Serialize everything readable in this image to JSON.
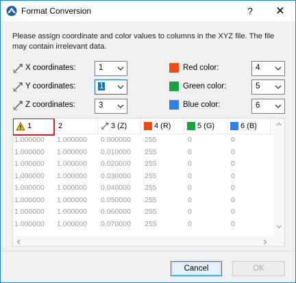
{
  "window": {
    "title": "Format Conversion",
    "help_glyph": "?",
    "close_glyph": "✕"
  },
  "instructions": "Please assign coordinate and color values to columns in the XYZ file. The file may contain irrelevant data.",
  "coords": [
    {
      "label": "X coordinates:",
      "value": "1",
      "icon": "x-axis-icon"
    },
    {
      "label": "Y coordinates:",
      "value": "1",
      "icon": "y-axis-icon",
      "focused": true
    },
    {
      "label": "Z coordinates:",
      "value": "3",
      "icon": "z-axis-icon"
    }
  ],
  "colors": [
    {
      "label": "Red color:",
      "value": "4",
      "swatch": "#f24b12"
    },
    {
      "label": "Green color:",
      "value": "5",
      "swatch": "#17a340"
    },
    {
      "label": "Blue color:",
      "value": "6",
      "swatch": "#2f80ed"
    }
  ],
  "table": {
    "headers": [
      {
        "text": "1",
        "icon": "warning-icon"
      },
      {
        "text": "2"
      },
      {
        "text": "3 (Z)",
        "icon": "z-axis-icon"
      },
      {
        "text": "4 (R)",
        "swatch": "#f24b12"
      },
      {
        "text": "5 (G)",
        "swatch": "#17a340"
      },
      {
        "text": "6 (B)",
        "swatch": "#2f80ed"
      }
    ],
    "rows": [
      [
        "1.000000",
        "1.000000",
        "0.000000",
        "255",
        "0",
        "0"
      ],
      [
        "1.000000",
        "1.000000",
        "0.010000",
        "255",
        "0",
        "0"
      ],
      [
        "1.000000",
        "1.000000",
        "0.020000",
        "255",
        "0",
        "0"
      ],
      [
        "1.000000",
        "1.000000",
        "0.030000",
        "255",
        "0",
        "0"
      ],
      [
        "1.000000",
        "1.000000",
        "0.040000",
        "255",
        "0",
        "0"
      ],
      [
        "1.000000",
        "1.000000",
        "0.050000",
        "255",
        "0",
        "0"
      ],
      [
        "1.000000",
        "1.000000",
        "0.060000",
        "255",
        "0",
        "0"
      ],
      [
        "1.000000",
        "1.000000",
        "0.070000",
        "255",
        "0",
        "0"
      ]
    ]
  },
  "buttons": {
    "cancel": "Cancel",
    "ok": "OK"
  }
}
